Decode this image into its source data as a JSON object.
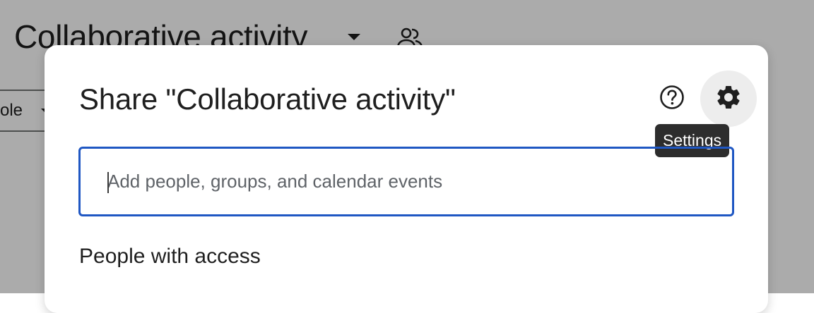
{
  "background": {
    "doc_title": "Collaborative activity",
    "select_label": "ole"
  },
  "dialog": {
    "title": "Share \"Collaborative activity\"",
    "help_icon": "help-circle-icon",
    "settings_icon": "gear-icon",
    "settings_tooltip": "Settings",
    "search": {
      "value": "",
      "placeholder": "Add people, groups, and calendar events"
    },
    "people_heading": "People with access"
  },
  "colors": {
    "scrim": "#000000",
    "input_border": "#1f57c3",
    "tooltip_bg": "#2d2d2d",
    "settings_hover_bg": "#ededed"
  }
}
